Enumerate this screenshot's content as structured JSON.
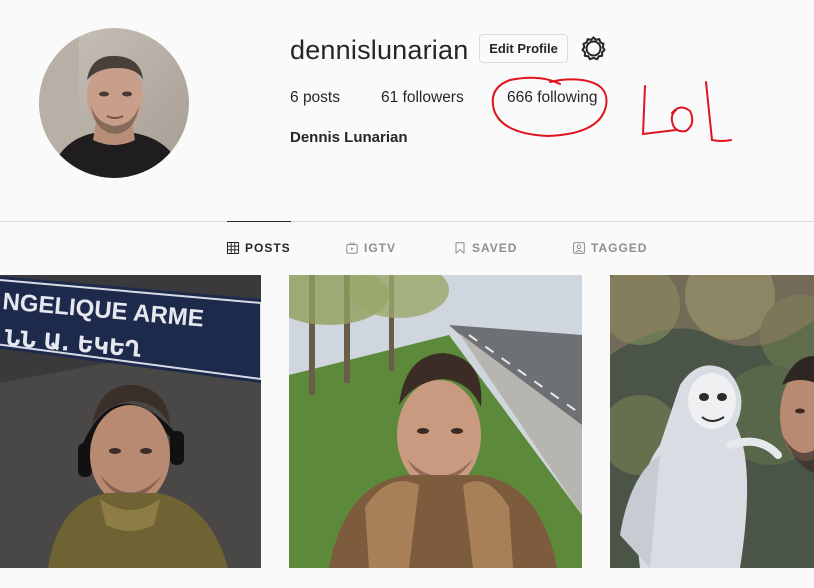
{
  "profile": {
    "username": "dennislunarian",
    "edit_label": "Edit Profile",
    "full_name": "Dennis Lunarian",
    "settings_icon": "gear-icon",
    "posts_count": "6",
    "posts_label": "posts",
    "followers_count": "61",
    "followers_label": "followers",
    "following_count": "666",
    "following_label": "following"
  },
  "annotation": {
    "text": "LoL",
    "color": "#e0141e"
  },
  "tabs": [
    {
      "label": "POSTS",
      "icon": "grid-icon",
      "active": true
    },
    {
      "label": "IGTV",
      "icon": "tv-icon",
      "active": false
    },
    {
      "label": "SAVED",
      "icon": "bookmark-icon",
      "active": false
    },
    {
      "label": "TAGGED",
      "icon": "tag-person-icon",
      "active": false
    }
  ],
  "posts_grid": {
    "street_sign_text_line1": "NGELIQUE ARME",
    "street_sign_text_line2": "ՆՆ Ա. ԵԿԵՂ"
  },
  "colors": {
    "text": "#262626",
    "muted": "#8e8e8e",
    "border": "#dbdbdb",
    "background": "#fafafa",
    "scribble": "#e0141e"
  }
}
